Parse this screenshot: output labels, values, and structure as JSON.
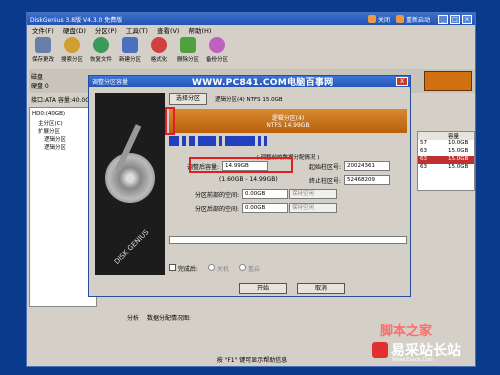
{
  "window": {
    "title": "DiskGenius 3.8版 V4.3.0 免费版",
    "link1": "关闭",
    "link2": "重新启动"
  },
  "menu": [
    "文件(F)",
    "硬盘(D)",
    "分区(P)",
    "工具(T)",
    "查看(V)",
    "帮助(H)"
  ],
  "toolbar": [
    "保存更改",
    "搜索分区",
    "恢复文件",
    "新建分区",
    "格式化",
    "删除分区",
    "备份分区"
  ],
  "diskbar": {
    "label": "硬盘 0"
  },
  "infobar": "接口:ATA  容量:40.0G",
  "tree": [
    "HD0:(40GB)",
    "主分区(C)",
    "扩展分区",
    "逻辑分区",
    "逻辑分区"
  ],
  "ptable": {
    "header": [
      "",
      "容量"
    ],
    "rows": [
      [
        "57",
        "10.0GB"
      ],
      [
        "63",
        "15.0GB"
      ],
      [
        "63",
        "15.0GB"
      ],
      [
        "63",
        "15.0GB"
      ]
    ]
  },
  "bottom_tabs": [
    "分析",
    "数据分配情况图:"
  ],
  "statusbar": "按 \"F1\" 键可显示帮助信息",
  "dialog": {
    "title": "调整分区容量",
    "watermark": "WWW.PC841.COM电脑百事网",
    "close": "X",
    "select_button": "选择分区",
    "selected_partition": "逻辑分区(4) NTFS 15.0GB",
    "bar_line1": "逻辑分区(4)",
    "bar_line2": "NTFS 14.99GB",
    "section_title": "( 调整前的数据分配情况 )",
    "size_label": "调整后容量:",
    "size_value": "14.99GB",
    "size_range": "(1.60GB - 14.99GB)",
    "start_label": "起始柱区号:",
    "start_value": "20024361",
    "end_label": "终止柱区号:",
    "end_value": "52468209",
    "before_label": "分区前部的空间:",
    "before_value": "0.00GB",
    "before_select": "保持空闲",
    "after_label": "分区后部的空间:",
    "after_value": "0.00GB",
    "after_select": "保持空闲",
    "after_done": "完成后:",
    "opt1": "关机",
    "opt2": "重启",
    "start_btn": "开始",
    "cancel_btn": "取消",
    "disk_brand": "DISK GENIUS"
  },
  "logo": {
    "text": "易采站长站",
    "sub": "Www.Easck.Com",
    "red_text": "脚本之家"
  },
  "colors": {
    "partition_orange": "#c8700f",
    "highlight_red": "#e02020",
    "title_blue": "#2a5fc4"
  }
}
